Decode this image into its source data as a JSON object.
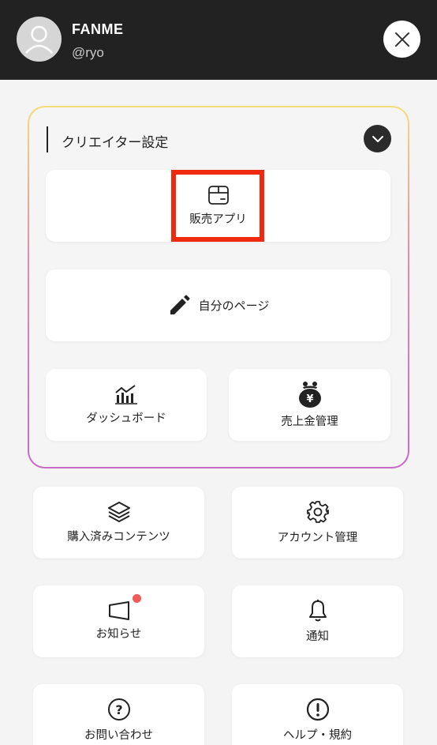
{
  "header": {
    "username": "FANME",
    "handle": "@ryo",
    "avatar_icon": "user-avatar-icon",
    "close_icon": "close-icon",
    "background": "#222222"
  },
  "creator_settings": {
    "title": "クリエイター設定",
    "collapse_icon": "chevron-down-icon",
    "items": [
      {
        "label": "販売アプリ",
        "icon": "box-icon"
      },
      {
        "label": "自分のページ",
        "icon": "pencil-icon"
      },
      {
        "label": "ダッシュボード",
        "icon": "chart-icon"
      },
      {
        "label": "売上金管理",
        "icon": "money-bag-icon"
      }
    ]
  },
  "menu": {
    "items": [
      {
        "label": "購入済みコンテンツ",
        "icon": "layers-icon"
      },
      {
        "label": "アカウント管理",
        "icon": "gear-icon"
      },
      {
        "label": "お知らせ",
        "icon": "megaphone-icon",
        "has_badge": true
      },
      {
        "label": "通知",
        "icon": "bell-icon"
      },
      {
        "label": "お問い合わせ",
        "icon": "question-icon"
      },
      {
        "label": "ヘルプ・規約",
        "icon": "exclamation-icon"
      }
    ]
  },
  "colors": {
    "highlight": "#f02a0f",
    "badge": "#f15a5a",
    "frame_gradient_top": "#f3dd7a",
    "frame_gradient_bottom": "#c86ac8"
  }
}
